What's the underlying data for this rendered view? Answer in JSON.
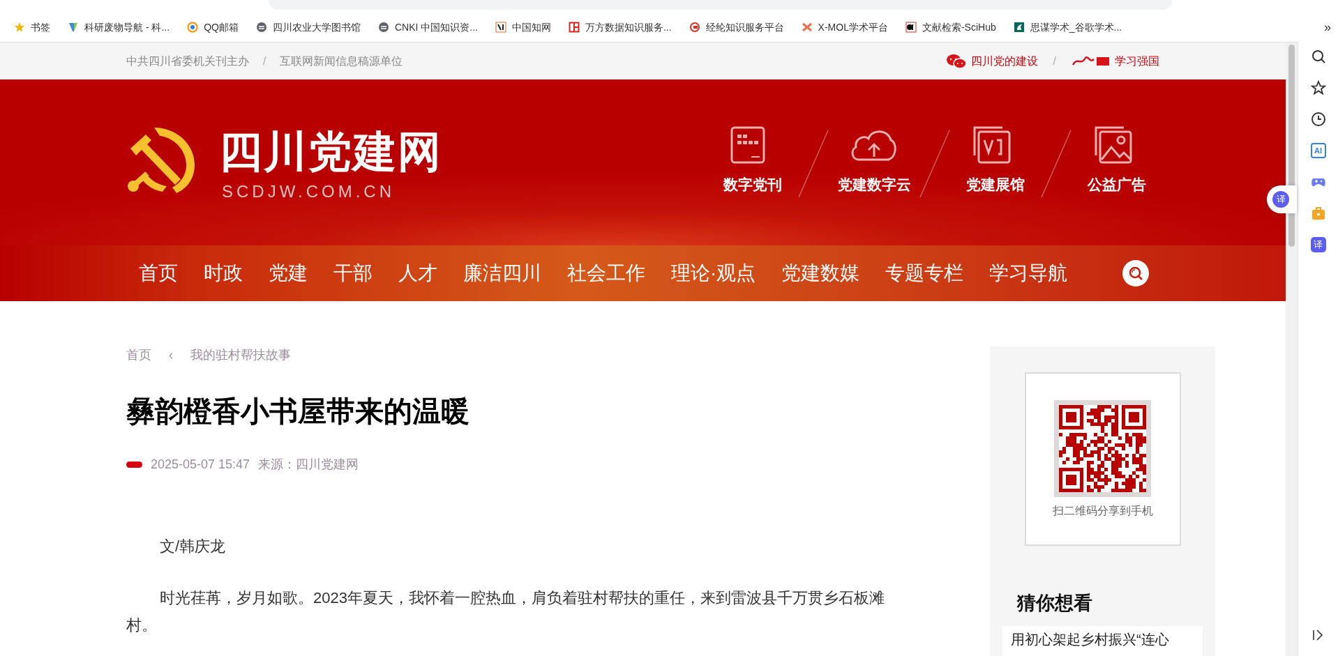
{
  "browser": {
    "bookmarks": [
      {
        "label": "书签"
      },
      {
        "label": "科研废物导航 - 科..."
      },
      {
        "label": "QQ邮箱"
      },
      {
        "label": "四川农业大学图书馆"
      },
      {
        "label": "CNKI 中国知识资..."
      },
      {
        "label": "中国知网"
      },
      {
        "label": "万方数据知识服务..."
      },
      {
        "label": "经纶知识服务平台"
      },
      {
        "label": "X-MOL学术平台"
      },
      {
        "label": "文献检索-SciHub"
      },
      {
        "label": "思谋学术_谷歌学术..."
      }
    ],
    "overflow": "»",
    "side_panel": [
      {
        "kind": "search"
      },
      {
        "kind": "star"
      },
      {
        "kind": "history"
      },
      {
        "kind": "ai",
        "label": "AI"
      },
      {
        "kind": "game"
      },
      {
        "kind": "briefcase"
      },
      {
        "kind": "translate",
        "label": "译"
      }
    ],
    "translate_bubble": "译"
  },
  "top_strip": {
    "left": [
      "中共四川省委机关刊主办",
      "互联网新闻信息稿源单位"
    ],
    "separator": "/",
    "right": [
      {
        "kind": "wechat",
        "label": "四川党的建设"
      },
      {
        "kind": "xuexi",
        "label": "学习强国"
      }
    ]
  },
  "header": {
    "logo_title": "四川党建网",
    "logo_domain": "SCDJW.COM.CN",
    "shortcuts": [
      {
        "kind": "journal",
        "label": "数字党刊"
      },
      {
        "kind": "cloud",
        "label": "党建数字云"
      },
      {
        "kind": "vr",
        "label": "党建展馆"
      },
      {
        "kind": "picture",
        "label": "公益广告"
      }
    ]
  },
  "nav": {
    "items": [
      "首页",
      "时政",
      "党建",
      "干部",
      "人才",
      "廉洁四川",
      "社会工作",
      "理论·观点",
      "党建数媒",
      "专题专栏",
      "学习导航"
    ]
  },
  "breadcrumb": {
    "items": [
      "首页",
      "我的驻村帮扶故事"
    ],
    "separator": "‹"
  },
  "article": {
    "title": "彝韵橙香小书屋带来的温暖",
    "date": "2025-05-07 15:47",
    "source": "来源：四川党建网",
    "paragraphs": [
      "文/韩庆龙",
      "时光荏苒，岁月如歌。2023年夏天，我怀着一腔热血，肩负着驻村帮扶的重任，来到雷波县千万贯乡石板滩村。"
    ]
  },
  "sidebar": {
    "qr_caption": "扫二维码分享到手机",
    "section_title": "猜你想看",
    "items": [
      "用初心架起乡村振兴“连心"
    ]
  }
}
